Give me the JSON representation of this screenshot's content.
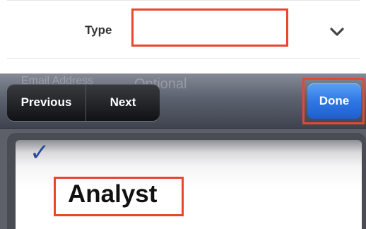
{
  "form": {
    "type_label": "Type",
    "type_value": ""
  },
  "background_form": {
    "faded_label": "Email Address",
    "faded_placeholder": "Optional"
  },
  "toolbar": {
    "previous_label": "Previous",
    "next_label": "Next",
    "done_label": "Done"
  },
  "picker": {
    "selected_check": "✓",
    "selected_option": "Analyst"
  },
  "colors": {
    "highlight": "#e8472e",
    "done_button": "#2f78e6",
    "check": "#2a4e99"
  }
}
